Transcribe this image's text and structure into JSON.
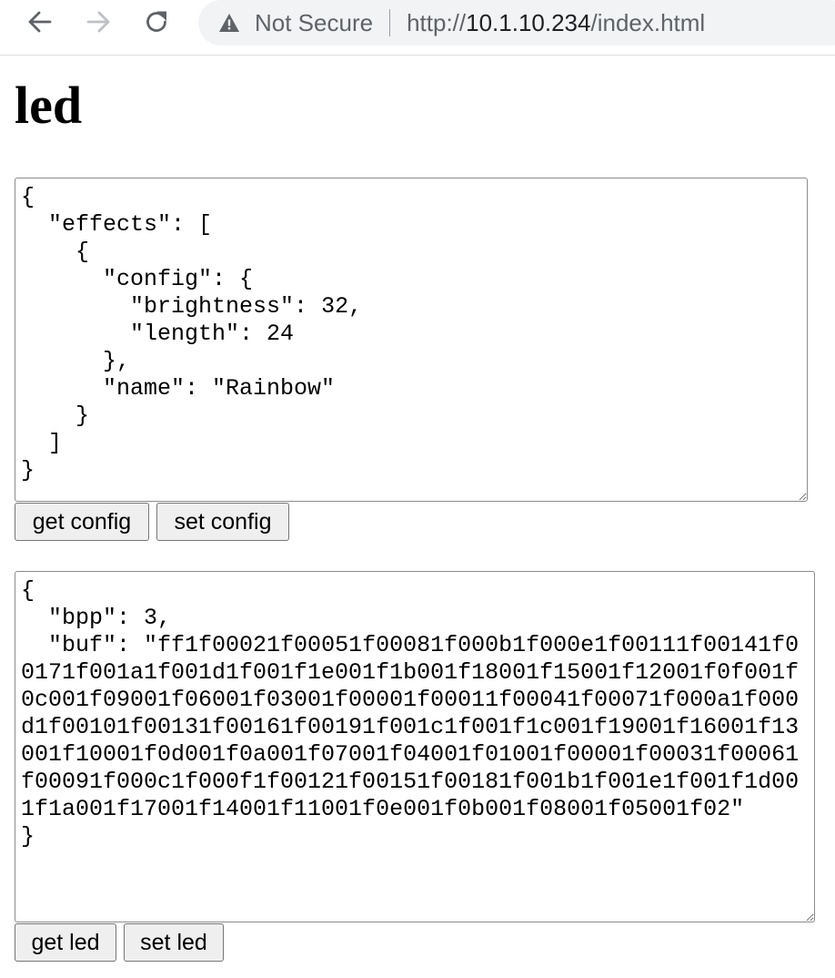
{
  "browser": {
    "security_label": "Not Secure",
    "url_scheme": "http://",
    "url_host": "10.1.10.234",
    "url_path": "/index.html",
    "icons": {
      "back": "arrow-left-icon",
      "forward": "arrow-right-icon",
      "reload": "reload-icon",
      "security": "warning-triangle-icon"
    }
  },
  "page": {
    "title": "led",
    "config_text": "{\n  \"effects\": [\n    {\n      \"config\": {\n        \"brightness\": 32,\n        \"length\": 24\n      },\n      \"name\": \"Rainbow\"\n    }\n  ]\n}",
    "led_text": "{\n  \"bpp\": 3,\n  \"buf\": \"ff1f00021f00051f00081f000b1f000e1f00111f00141f00171f001a1f001d1f001f1e001f1b001f18001f15001f12001f0f001f0c001f09001f06001f03001f00001f00011f00041f00071f000a1f000d1f00101f00131f00161f00191f001c1f001f1c001f19001f16001f13001f10001f0d001f0a001f07001f04001f01001f00001f00031f00061f00091f000c1f000f1f00121f00151f00181f001b1f001e1f001f1d001f1a001f17001f14001f11001f0e001f0b001f08001f05001f02\"\n}",
    "buttons": {
      "get_config": "get config",
      "set_config": "set config",
      "get_led": "get led",
      "set_led": "set led"
    }
  }
}
